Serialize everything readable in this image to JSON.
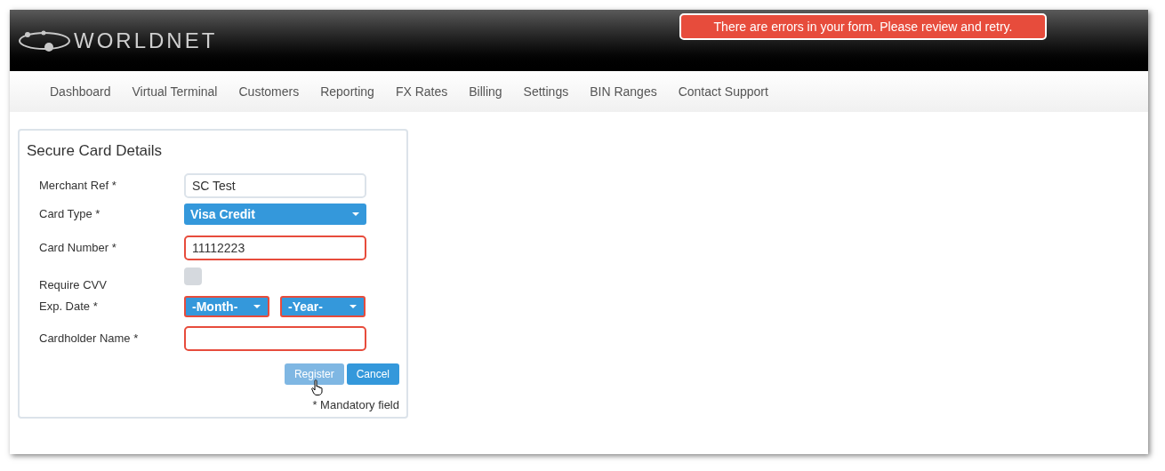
{
  "header": {
    "logo": "WORLDNET",
    "alert": "There are errors in your form. Please review and retry."
  },
  "nav": [
    {
      "label": "Dashboard"
    },
    {
      "label": "Virtual Terminal"
    },
    {
      "label": "Customers"
    },
    {
      "label": "Reporting"
    },
    {
      "label": "FX Rates"
    },
    {
      "label": "Billing"
    },
    {
      "label": "Settings"
    },
    {
      "label": "BIN Ranges"
    },
    {
      "label": "Contact Support"
    }
  ],
  "form": {
    "title": "Secure Card Details",
    "fields": [
      {
        "kind": "text",
        "label": "Merchant Ref *",
        "value": "SC Test",
        "error": false
      },
      {
        "kind": "select",
        "label": "Card Type *",
        "value": "Visa Credit",
        "error": false
      },
      {
        "kind": "text",
        "label": "Card Number *",
        "value": "11112223",
        "error": true
      },
      {
        "kind": "checkbox",
        "label": "Require CVV",
        "checked": false
      },
      {
        "kind": "select-pair",
        "label": "Exp. Date *",
        "values": [
          "-Month-",
          "-Year-"
        ],
        "error": true
      },
      {
        "kind": "text",
        "label": "Cardholder Name *",
        "error": true
      }
    ],
    "buttons": [
      {
        "label": "Register",
        "disabled": true
      },
      {
        "label": "Cancel",
        "disabled": false
      }
    ],
    "note": "* Mandatory field"
  }
}
